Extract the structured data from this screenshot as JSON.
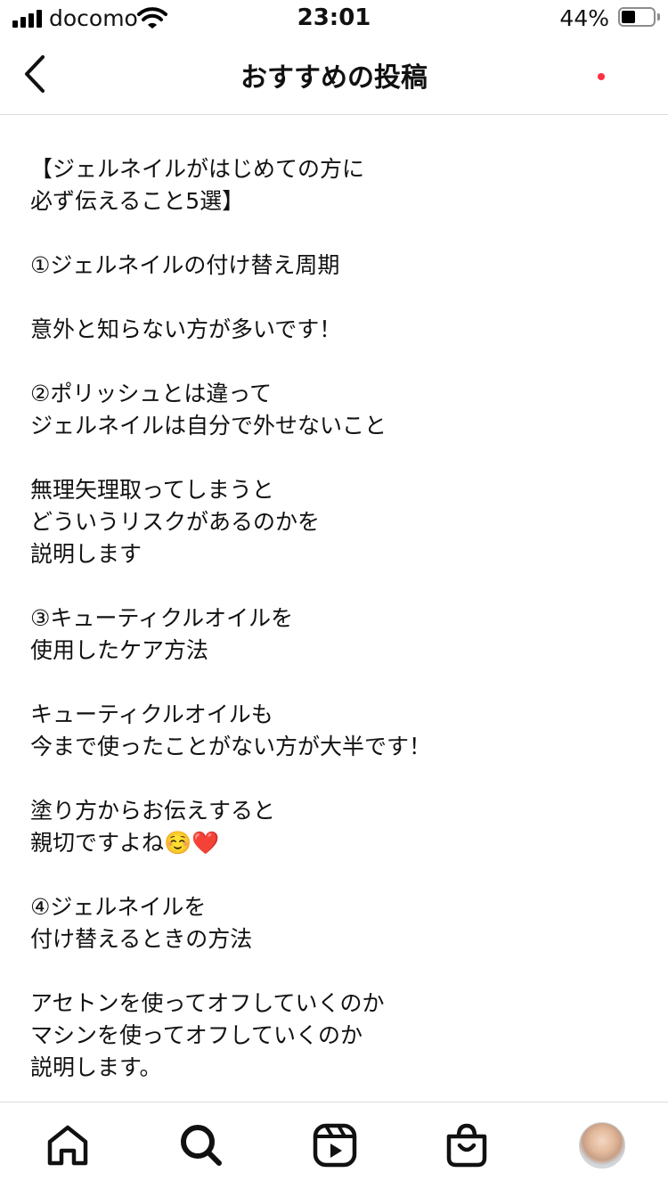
{
  "status_bar": {
    "carrier": "docomo",
    "time": "23:01",
    "battery_percent": "44%",
    "battery_level": 0.44
  },
  "header": {
    "title": "おすすめの投稿"
  },
  "post": {
    "text": "【ジェルネイルがはじめての方に\n必ず伝えること5選】\n\n①ジェルネイルの付け替え周期\n\n意外と知らない方が多いです！\n\n②ポリッシュとは違って\nジェルネイルは自分で外せないこと\n\n無理矢理取ってしまうと\nどういうリスクがあるのかを\n説明します\n\n③キューティクルオイルを\n使用したケア方法\n\nキューティクルオイルも\n今まで使ったことがない方が大半です！\n\n塗り方からお伝えすると\n親切ですよね☺️❤️\n\n④ジェルネイルを\n付け替えるときの方法\n\nアセトンを使ってオフしていくのか\nマシンを使ってオフしていくのか\n説明します。"
  },
  "bottom_nav": {
    "items": [
      {
        "icon": "home-icon"
      },
      {
        "icon": "search-icon"
      },
      {
        "icon": "reels-icon"
      },
      {
        "icon": "shop-icon"
      },
      {
        "icon": "profile-avatar"
      }
    ],
    "notification_dot_color": "#ff3040"
  }
}
